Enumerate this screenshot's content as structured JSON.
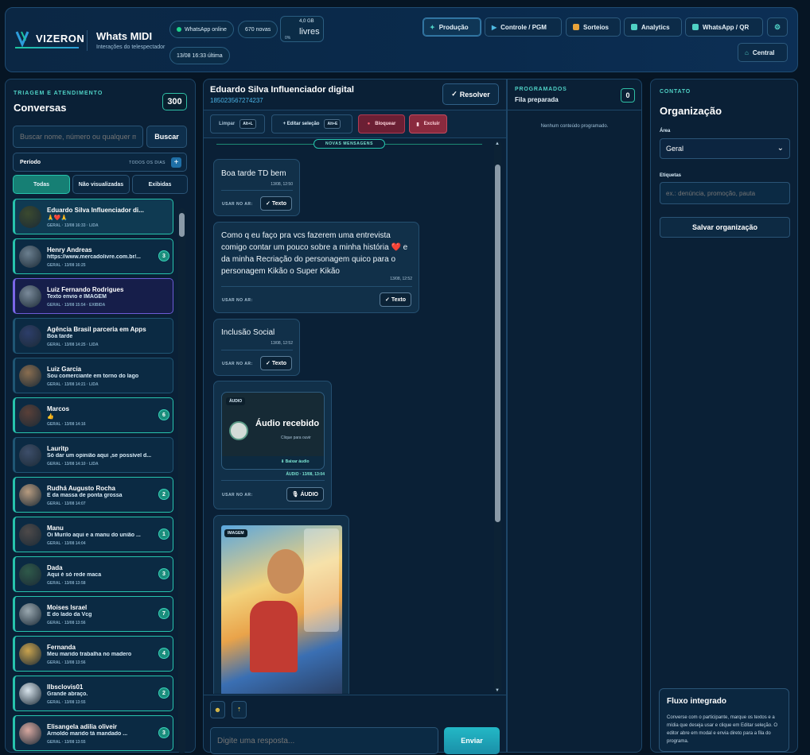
{
  "header": {
    "logo_text": "VIZERON",
    "app_title": "Whats MIDI",
    "app_subtitle": "Interações do telespectador",
    "whatsapp_status": "WhatsApp online",
    "new_count": "670 novas",
    "storage_size": "4,0 GB",
    "storage_label": "livres",
    "storage_unit": "0%",
    "last_update": "13/08 16:33 última",
    "nav": [
      {
        "label": "Produção",
        "icon": "star-icon"
      },
      {
        "label": "Controle / PGM",
        "icon": "play-icon"
      },
      {
        "label": "Sorteios",
        "icon": "gift-icon"
      },
      {
        "label": "Analytics",
        "icon": "chart-icon"
      },
      {
        "label": "WhatsApp / QR",
        "icon": "qr-icon"
      }
    ],
    "central_label": "Central"
  },
  "left": {
    "kicker": "TRIAGEM E ATENDIMENTO",
    "title": "Conversas",
    "count": "300",
    "search_placeholder": "Buscar nome, número ou qualquer me",
    "search_button": "Buscar",
    "period_label": "Período",
    "period_value": "TODOS OS DIAS",
    "filters": [
      "Todas",
      "Não visualizadas",
      "Exibidas"
    ],
    "conversations": [
      {
        "name": "Eduardo Silva Influenciador di...",
        "preview": "🙏❤️🙏",
        "meta": "GERAL · 13/08 16:33 · LIDA",
        "unread": "",
        "state": "sel"
      },
      {
        "name": "Henry Andreas",
        "preview": "https://www.mercadolivre.com.br/...",
        "meta": "GERAL · 13/08 16:25",
        "unread": "3",
        "state": "unread"
      },
      {
        "name": "Luiz Fernando Rodrigues",
        "preview": "Texto envio e IMAGEM",
        "meta": "GERAL · 13/08 15:54 · EXIBIDA",
        "unread": "",
        "state": "shown"
      },
      {
        "name": "Agência Brasil parceria em Apps",
        "preview": "Boa tarde",
        "meta": "GERAL · 13/08 14:25 · LIDA",
        "unread": "",
        "state": ""
      },
      {
        "name": "Luiz Garcia",
        "preview": "Sou comerciante em torno do lago",
        "meta": "GERAL · 13/08 14:21 · LIDA",
        "unread": "",
        "state": ""
      },
      {
        "name": "Marcos",
        "preview": "👍",
        "meta": "GERAL · 13/08 14:16",
        "unread": "6",
        "state": "unread"
      },
      {
        "name": "Lauritp",
        "preview": "Só dar um opinião aqui ,se possível d...",
        "meta": "GERAL · 13/08 14:10 · LIDA",
        "unread": "",
        "state": ""
      },
      {
        "name": "Rudhá Augusto Rocha",
        "preview": "É da massa de ponta grossa",
        "meta": "GERAL · 13/08 14:07",
        "unread": "2",
        "state": "unread"
      },
      {
        "name": "Manu",
        "preview": "Oi Murilo aqui e a manu do união ...",
        "meta": "GERAL · 13/08 14:04",
        "unread": "1",
        "state": "unread"
      },
      {
        "name": "Dada",
        "preview": "Aqui é só rede maca",
        "meta": "GERAL · 13/08 13:58",
        "unread": "3",
        "state": "unread"
      },
      {
        "name": "Moises Israel",
        "preview": "E do lado da Vcg",
        "meta": "GERAL · 13/08 13:56",
        "unread": "7",
        "state": "unread"
      },
      {
        "name": "Fernanda",
        "preview": "Meu marido trabalha no madero",
        "meta": "GERAL · 13/08 13:56",
        "unread": "4",
        "state": "unread"
      },
      {
        "name": "Ilbsclovis01",
        "preview": "Grande abraço.",
        "meta": "GERAL · 13/08 13:55",
        "unread": "2",
        "state": "unread"
      },
      {
        "name": "Elisangela adilia oliveir",
        "preview": "Arnoldo marido tá mandado ...",
        "meta": "GERAL · 13/08 13:55",
        "unread": "3",
        "state": "unread"
      }
    ]
  },
  "chat": {
    "contact_name": "Eduardo Silva Influenciador digital",
    "contact_number": "185023567274237",
    "resolve_label": "Resolver",
    "toolbar": {
      "clear": "Limpar",
      "clear_kbd": "Alt+L",
      "edit": "+ Editar seleção",
      "edit_kbd": "Alt+E",
      "block": "Bloquear",
      "delete": "Excluir"
    },
    "new_messages": "NOVAS MENSAGENS",
    "air_label": "USAR NO AR:",
    "messages": [
      {
        "text": "Boa tarde TD bem",
        "time": "13/08, 12:50",
        "btn": "✓ Texto"
      },
      {
        "text": "Como q eu faço pra vcs fazerem uma entrevista comigo contar um pouco sobre a minha história ❤️ e da minha Recriação do personagem quico para o personagem Kikão o Super Kikão",
        "time": "13/08, 12:52",
        "btn": "✓ Texto"
      },
      {
        "text": "Inclusão Social",
        "time": "13/08, 12:52",
        "btn": "✓ Texto"
      }
    ],
    "audio": {
      "tag": "ÁUDIO",
      "title": "Áudio recebido",
      "hint": "Clique para ouvir",
      "download": "⬇ Baixar áudio",
      "time": "ÁUDIO · 13/08, 13:04",
      "btn": "🎙 ÁUDIO"
    },
    "image_tag": "IMAGEM",
    "reply_placeholder": "Digite uma resposta...",
    "send_label": "Enviar"
  },
  "programmed": {
    "kicker": "PROGRAMADOS",
    "title": "Fila preparada",
    "count": "0",
    "empty": "Nenhum conteúdo programado."
  },
  "contact": {
    "kicker": "CONTATO",
    "title": "Organização",
    "area_label": "Área",
    "area_value": "Geral",
    "tags_label": "Etiquetas",
    "tags_placeholder": "ex.: denúncia, promoção, pauta",
    "save_label": "Salvar organização",
    "flow_title": "Fluxo integrado",
    "flow_text": "Converse com o participante, marque os textos e a mídia que deseja usar e clique em Editar seleção. O editor abre em modal e envia direto para a fila do programa."
  }
}
